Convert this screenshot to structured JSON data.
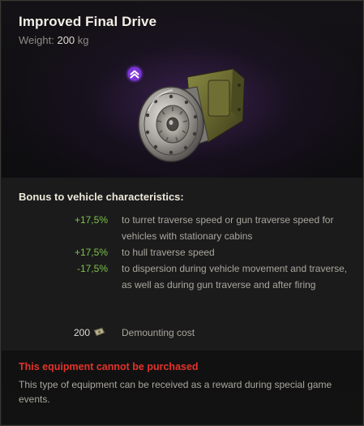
{
  "item": {
    "title": "Improved Final Drive",
    "weight_label": "Weight:",
    "weight_value": "200",
    "weight_unit": "kg",
    "image": "final-drive-gear-icon",
    "level_badge": "double-chevron-up-icon"
  },
  "characteristics": {
    "heading": "Bonus to vehicle characteristics:",
    "bonuses": [
      {
        "value": "+17,5%",
        "text": "to turret traverse speed or gun traverse speed for vehicles with stationary cabins"
      },
      {
        "value": "+17,5%",
        "text": "to hull traverse speed"
      },
      {
        "value": "-17,5%",
        "text": "to dispersion during vehicle movement and traverse, as well as during gun traverse and after firing"
      }
    ],
    "cost": {
      "value": "200",
      "icon": "credits-icon",
      "label": "Demounting cost"
    }
  },
  "footer": {
    "warning": "This equipment cannot be purchased",
    "note": "This type of equipment can be received as a reward during special game events."
  },
  "colors": {
    "bonus_green": "#7fc24a",
    "warning_red": "#e3332a",
    "badge_purple": "#9b46ff"
  }
}
